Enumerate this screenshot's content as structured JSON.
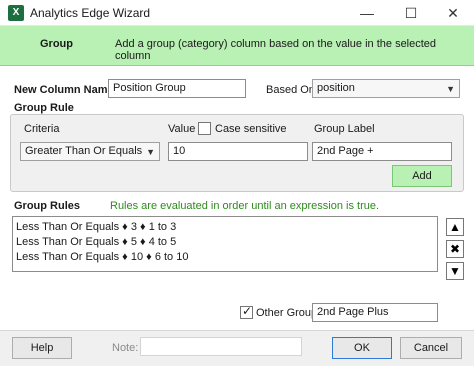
{
  "window": {
    "title": "Analytics Edge Wizard",
    "app_icon": "excel-icon",
    "icon_letter": "X",
    "minimize_glyph": "—",
    "maximize_glyph": "☐",
    "close_glyph": "✕"
  },
  "header": {
    "title": "Group",
    "description": "Add a group (category) column based on the value in the selected column"
  },
  "new_column": {
    "label": "New Column Name",
    "value": "Position Group",
    "based_on_label": "Based On",
    "based_on_value": "position"
  },
  "group_rule": {
    "legend": "Group Rule",
    "criteria_label": "Criteria",
    "criteria_value": "Greater Than Or Equals",
    "value_label": "Value",
    "case_sensitive_label": "Case sensitive",
    "case_sensitive_checked": false,
    "value_value": "10",
    "group_label_label": "Group Label",
    "group_label_value": "2nd Page +",
    "add_button": "Add"
  },
  "group_rules": {
    "title": "Group Rules",
    "hint": "Rules are evaluated in order until an expression is true.",
    "items": [
      "Less Than Or Equals ♦ 3 ♦ 1 to 3",
      "Less Than Or Equals ♦ 5 ♦ 4 to 5",
      "Less Than Or Equals ♦ 10 ♦ 6 to 10"
    ],
    "up_glyph": "▲",
    "delete_glyph": "✖",
    "down_glyph": "▼"
  },
  "other_group": {
    "label": "Other Group",
    "checked": true,
    "check_glyph": "✓",
    "value": "2nd Page Plus"
  },
  "footer": {
    "help_button": "Help",
    "note_label": "Note:",
    "note_value": "",
    "ok_button": "OK",
    "cancel_button": "Cancel"
  },
  "colors": {
    "header_bg": "#b9f0b4",
    "hint_text": "#2e8b1e",
    "add_button_bg": "#b9f0b4",
    "ok_border": "#2f7ad6"
  }
}
